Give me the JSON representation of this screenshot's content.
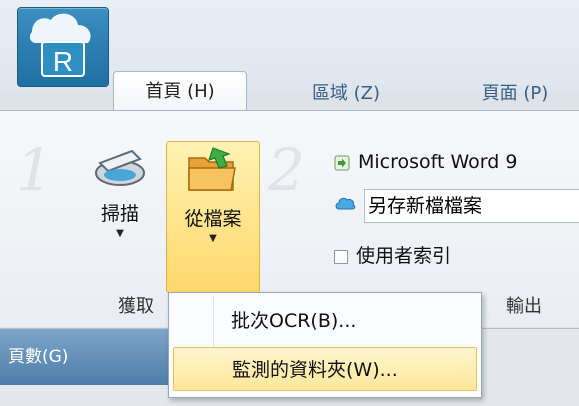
{
  "window": {
    "app_icon_letter": "R"
  },
  "tabs": [
    {
      "label": "首頁 (H)"
    },
    {
      "label": "區域 (Z)"
    },
    {
      "label": "頁面 (P)"
    }
  ],
  "ribbon": {
    "step1": "1",
    "step2": "2",
    "scan_label": "掃描",
    "from_file_label": "從檔案",
    "output_word": "Microsoft Word 9",
    "save_as": "另存新檔檔案",
    "user_index": "使用者索引",
    "group_acquire": "獲取",
    "group_output": "輸出"
  },
  "dropdown": {
    "items": [
      {
        "label": "批次OCR(B)..."
      },
      {
        "label": "監測的資料夾(W)..."
      }
    ]
  },
  "bottom": {
    "pane_title": "頁數(G)"
  },
  "colors": {
    "accent": "#2b7fb6",
    "highlight": "#ffd86b",
    "pane": "#4f7ea9"
  }
}
